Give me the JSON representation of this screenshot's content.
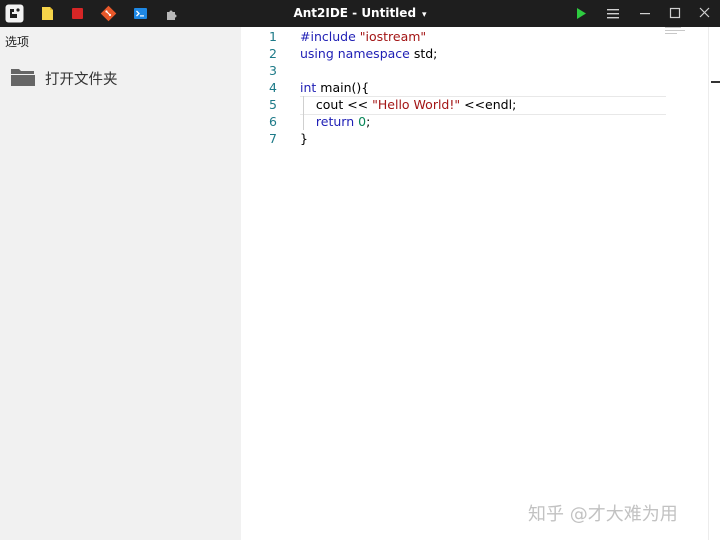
{
  "titlebar": {
    "title": "Ant2IDE - Untitled",
    "caret": "▾",
    "icons": [
      "app-logo-icon",
      "new-file-icon",
      "stop-icon",
      "git-icon",
      "terminal-icon",
      "extensions-icon"
    ],
    "actions": [
      "run-icon",
      "menu-icon",
      "minimize-icon",
      "maximize-icon",
      "close-icon"
    ]
  },
  "sidebar": {
    "title": "选项",
    "open_folder": "打开文件夹"
  },
  "editor": {
    "line_numbers": [
      "1",
      "2",
      "3",
      "4",
      "5",
      "6",
      "7"
    ],
    "lines": {
      "l1": {
        "a": "#include ",
        "b": "\"iostream\""
      },
      "l2": {
        "a": "using namespace",
        "b": " std;"
      },
      "l4": {
        "a": "int",
        "b": " main(){"
      },
      "l5": {
        "a": "    cout << ",
        "b": "\"Hello World!\"",
        "c": " <<endl;"
      },
      "l6": {
        "a": "    return",
        "b": " ",
        "c": "0",
        "d": ";"
      },
      "l7": {
        "a": "}"
      }
    }
  },
  "watermark": "知乎 @才大难为用",
  "colors": {
    "titlebar_bg": "#1e1e1e",
    "sidebar_bg": "#f1f1f1",
    "keyword": "#1f1fb5",
    "string": "#a31515",
    "number": "#098658",
    "line_number": "#1d7a88",
    "run_green": "#2ecc40"
  }
}
